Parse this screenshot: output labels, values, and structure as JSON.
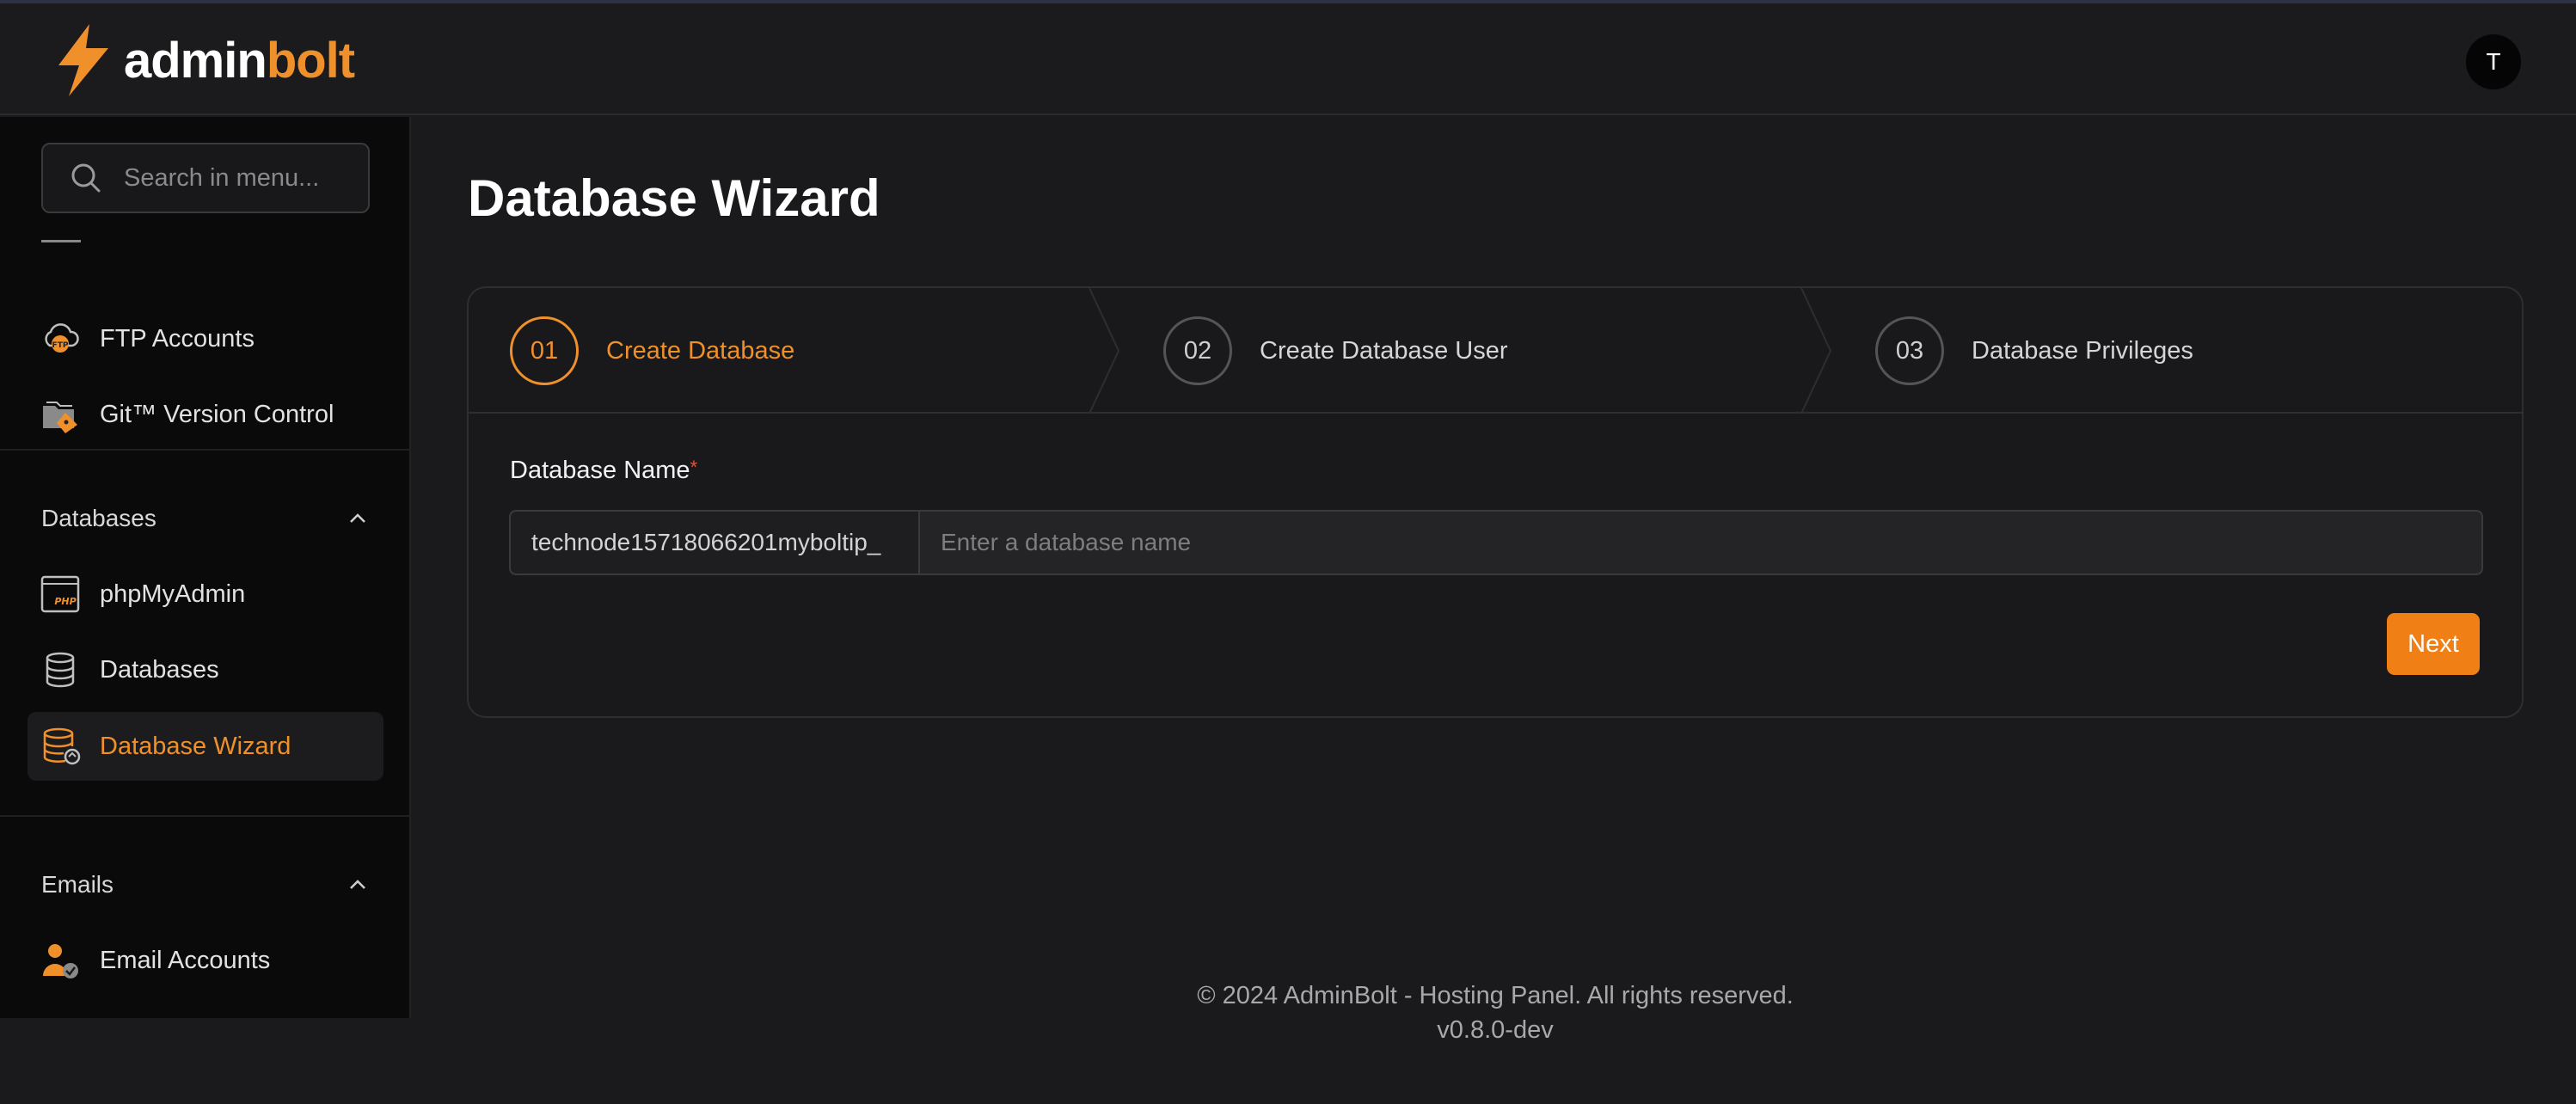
{
  "brand": {
    "part1": "admin",
    "part2": "bolt",
    "accent": "#f0902a"
  },
  "user": {
    "initial": "T"
  },
  "sidebar": {
    "search_placeholder": "Search in menu...",
    "files_items": [
      {
        "label": "FTP Accounts",
        "icon": "ftp-cloud-icon"
      },
      {
        "label": "Git™ Version Control",
        "icon": "git-folder-icon"
      }
    ],
    "databases_section": {
      "title": "Databases",
      "items": [
        {
          "label": "phpMyAdmin",
          "icon": "php-window-icon"
        },
        {
          "label": "Databases",
          "icon": "database-icon"
        },
        {
          "label": "Database Wizard",
          "icon": "database-wizard-icon"
        }
      ]
    },
    "emails_section": {
      "title": "Emails",
      "items": [
        {
          "label": "Email Accounts",
          "icon": "email-user-icon"
        }
      ]
    }
  },
  "page": {
    "title": "Database Wizard"
  },
  "wizard": {
    "steps": [
      {
        "num": "01",
        "label": "Create Database",
        "active": true
      },
      {
        "num": "02",
        "label": "Create Database User",
        "active": false
      },
      {
        "num": "03",
        "label": "Database Privileges",
        "active": false
      }
    ],
    "field_label": "Database Name",
    "required_mark": "*",
    "prefix": "technode15718066201myboltip_",
    "input_value": "",
    "input_placeholder": "Enter a database name",
    "next_label": "Next"
  },
  "footer": {
    "copyright": "© 2024 AdminBolt - Hosting Panel. All rights reserved.",
    "version": "v0.8.0-dev"
  }
}
